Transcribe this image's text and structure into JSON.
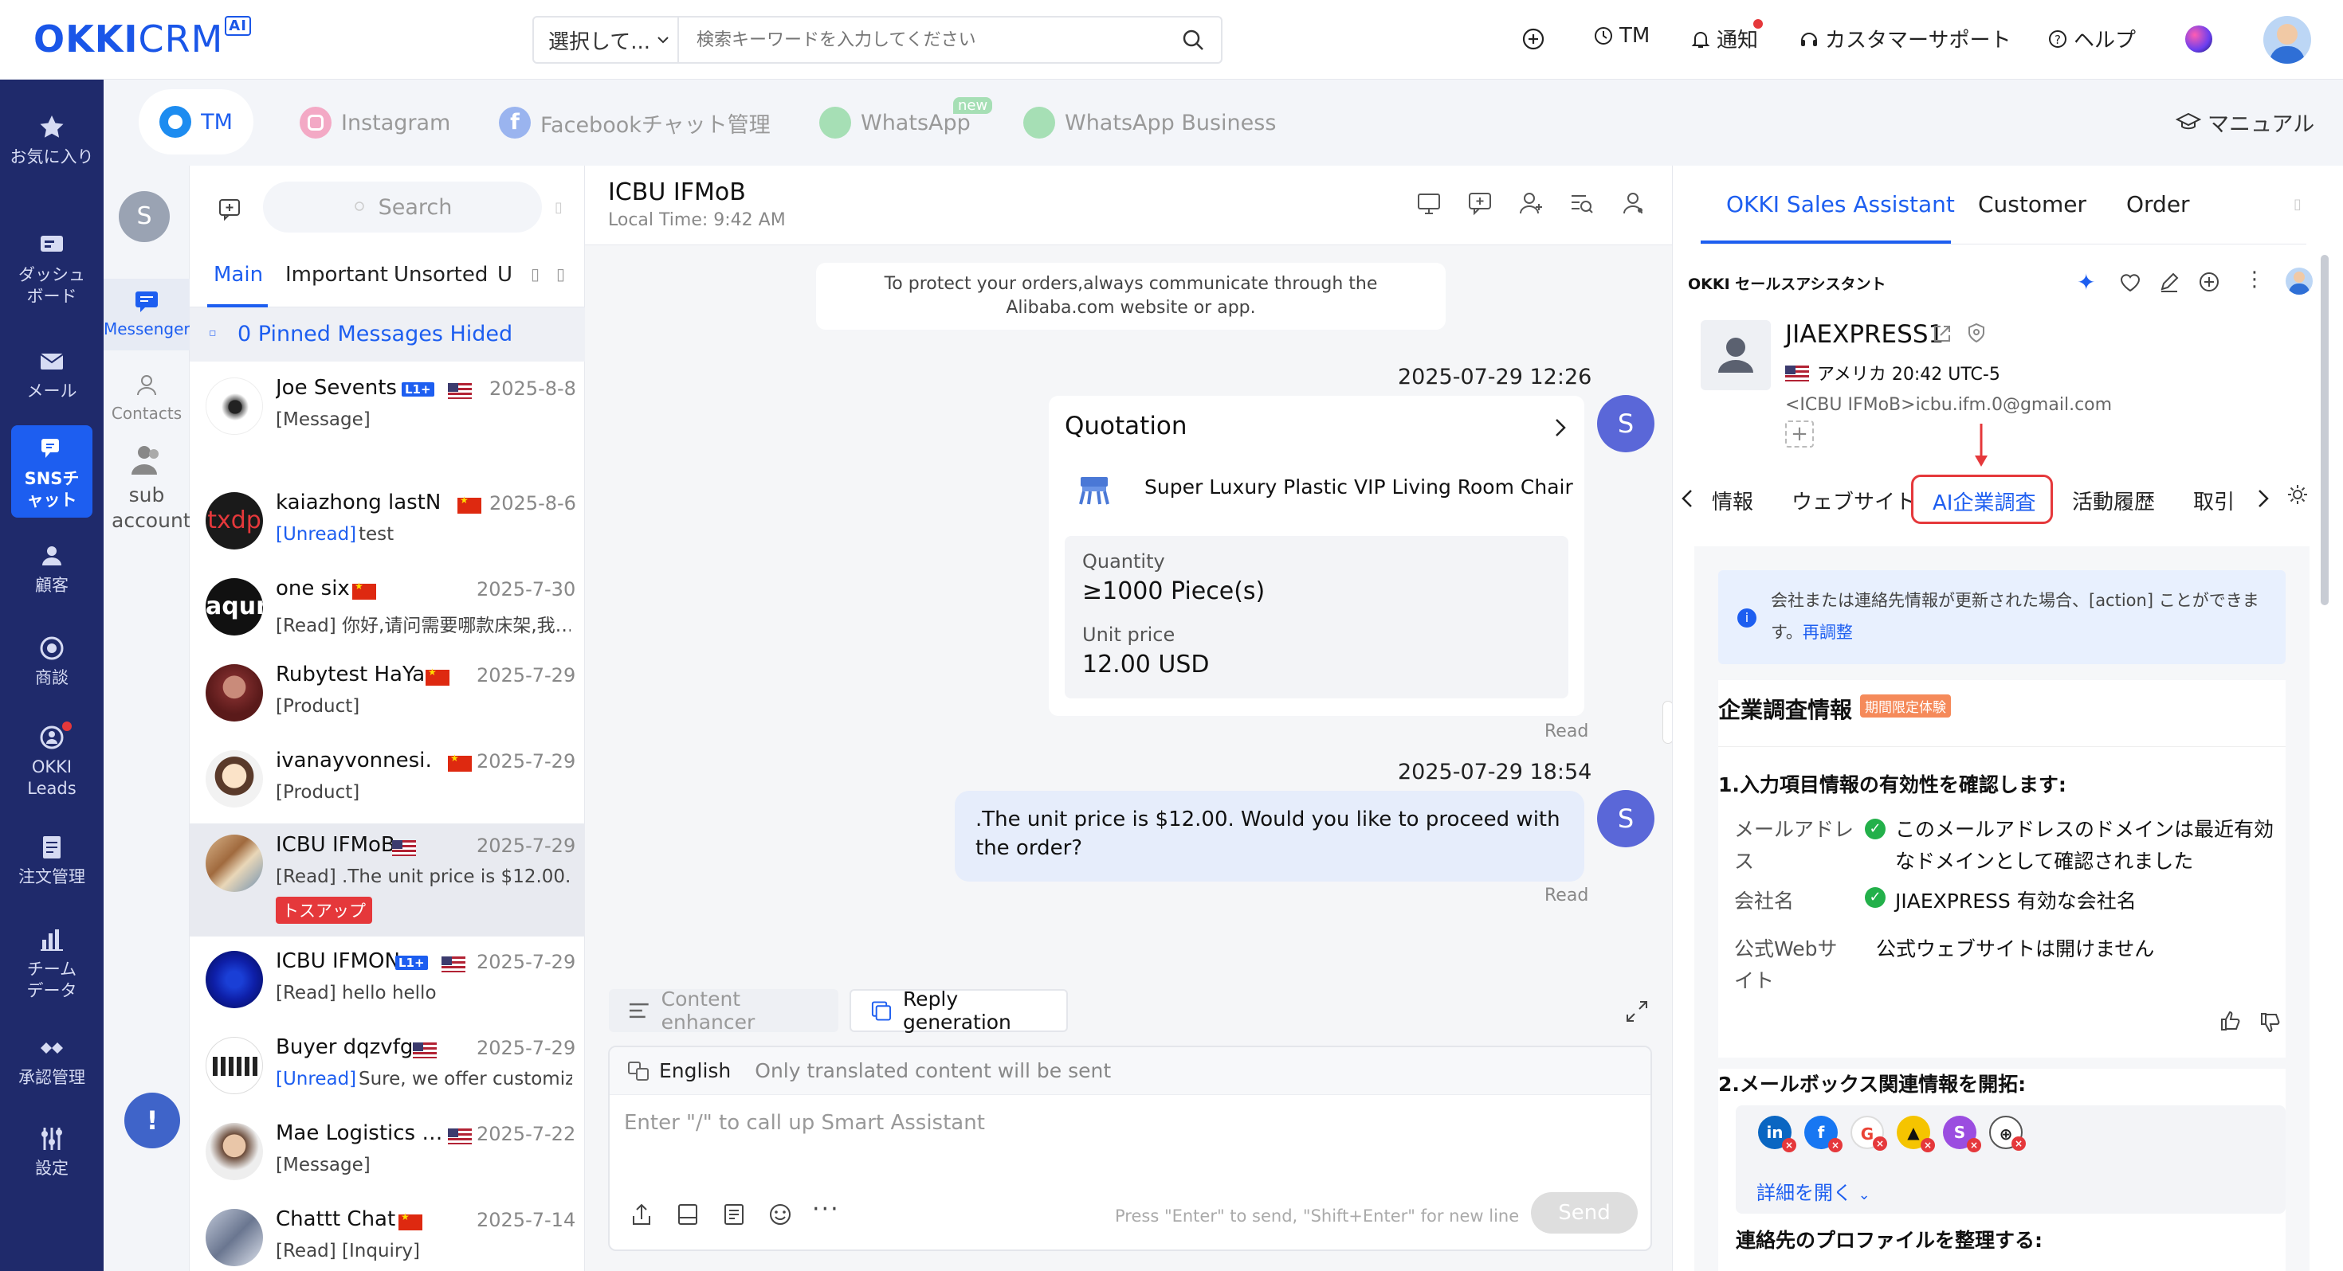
{
  "colors": {
    "primary": "#1d5ef0",
    "nav_bg": "#1f2a6b",
    "accent_red": "#e5383b",
    "tag_orange": "#f58a5a"
  },
  "topbar": {
    "logo": {
      "okki": "OKKI",
      "crm": "CRM",
      "ai": "AI"
    },
    "search_select": "選択して...",
    "search_placeholder": "検索キーワードを入力してください",
    "tm": "TM",
    "notify": "通知",
    "support": "カスタマーサポート",
    "help": "ヘルプ"
  },
  "leftnav": [
    {
      "label": "お気に入り",
      "icon": "star-icon"
    },
    {
      "label": "ダッシュボード",
      "icon": "dashboard-icon"
    },
    {
      "label": "メール",
      "icon": "mail-icon"
    },
    {
      "label": "SNSチャット",
      "icon": "chat-icon"
    },
    {
      "label": "顧客",
      "icon": "customers-icon"
    },
    {
      "label": "商談",
      "icon": "target-icon"
    },
    {
      "label": "OKKI Leads",
      "icon": "leads-icon"
    },
    {
      "label": "注文管理",
      "icon": "order-icon"
    },
    {
      "label": "チームデータ",
      "icon": "bar-chart-icon"
    },
    {
      "label": "承認管理",
      "icon": "approval-icon"
    },
    {
      "label": "設定",
      "icon": "settings-icon"
    }
  ],
  "channels": {
    "tm": "TM",
    "instagram": "Instagram",
    "facebook": "Facebookチャット管理",
    "whatsapp": "WhatsApp",
    "whatsapp_new": "new",
    "whatsapp_business": "WhatsApp Business",
    "manual": "マニュアル"
  },
  "subnav": {
    "avatar": "S",
    "messenger": "Messenger",
    "contacts": "Contacts",
    "sub_account": "sub account"
  },
  "convlist": {
    "search_placeholder": "Search",
    "tabs": [
      "Main",
      "Important",
      "Unsorted",
      "U"
    ],
    "pinned": "0 Pinned Messages Hided",
    "items": [
      {
        "name": "Joe Sevents",
        "badge": "L1+",
        "flag": "us",
        "date": "2025-8-8",
        "status": "",
        "preview": "[Message]"
      },
      {
        "name": "kaiazhong lastN…",
        "badge": "",
        "flag": "cn",
        "date": "2025-8-6",
        "status": "[Unread]",
        "preview": "test"
      },
      {
        "name": "one six",
        "badge": "",
        "flag": "cn",
        "date": "2025-7-30",
        "status": "",
        "preview": "[Read]  你好,请问需要哪款床架,我…"
      },
      {
        "name": "Rubytest HaYa",
        "badge": "",
        "flag": "cn",
        "date": "2025-7-29",
        "status": "",
        "preview": "[Product]"
      },
      {
        "name": "ivanayvonnesi…",
        "badge": "",
        "flag": "cn",
        "date": "2025-7-29",
        "status": "",
        "preview": "[Product]"
      },
      {
        "name": "ICBU IFMoB",
        "badge": "",
        "flag": "us",
        "date": "2025-7-29",
        "status": "",
        "preview": "[Read]  .The unit price is $12.00. …",
        "tag": "トスアップ"
      },
      {
        "name": "ICBU IFMON",
        "badge": "L1+",
        "flag": "us",
        "date": "2025-7-29",
        "status": "",
        "preview": "[Read]  hello hello"
      },
      {
        "name": "Buyer dqzvfg",
        "badge": "",
        "flag": "us",
        "date": "2025-7-29",
        "status": "[Unread]",
        "preview": "Sure, we offer customiz…"
      },
      {
        "name": "Mae Logistics …",
        "badge": "",
        "flag": "us",
        "date": "2025-7-22",
        "status": "",
        "preview": "[Message]"
      },
      {
        "name": "Chattt Chat",
        "badge": "",
        "flag": "cn",
        "date": "2025-7-14",
        "status": "",
        "preview": "[Read]  [Inquiry]"
      }
    ],
    "avatar_texts": {
      "txdp": "txdp",
      "aqur": "aqur"
    }
  },
  "chat": {
    "title": "ICBU IFMoB",
    "local_time": "Local Time: 9:42 AM",
    "notice": "To protect your orders,always communicate through the Alibaba.com website or app.",
    "time1": "2025-07-29 12:26",
    "quotation": {
      "title": "Quotation",
      "product": "Super Luxury Plastic VIP Living Room Chair",
      "qty_label": "Quantity",
      "qty_value": "≥1000 Piece(s)",
      "price_label": "Unit price",
      "price_value": "12.00 USD"
    },
    "read1": "Read",
    "time2": "2025-07-29 18:54",
    "message2": ".The unit price is $12.00. Would you like to proceed with the order?",
    "read2": "Read",
    "sender": "S"
  },
  "composer": {
    "content_enhancer": "Content enhancer",
    "reply_generation": "Reply generation",
    "language": "English",
    "translate_hint": "Only translated content will be sent",
    "placeholder": "Enter \"/\" to call up Smart Assistant",
    "send_hint": "Press \"Enter\" to send, \"Shift+Enter\" for new line",
    "send": "Send"
  },
  "rightpanel": {
    "tabs": [
      "OKKI Sales Assistant",
      "Customer",
      "Order"
    ],
    "assistant_label": "OKKI セールスアシスタント",
    "contact": {
      "name": "JIAEXPRESS1",
      "location": "アメリカ 20:42 UTC-5",
      "email": "<ICBU IFMoB>icbu.ifm.0@gmail.com"
    },
    "info_tabs": [
      "情報",
      "ウェブサイト",
      "AI企業調査",
      "活動履歴",
      "取引"
    ],
    "notice": "会社または連絡先情報が更新された場合、[action] ことができます。",
    "notice_link": "再調整",
    "section_title": "企業調査情報",
    "section_tag": "期間限定体験",
    "step1": "1.入力項目情報の有効性を確認します:",
    "rows": [
      {
        "label": "メールアドレス",
        "value": "このメールアドレスのドメインは最近有効なドメインとして確認されました",
        "ok": true
      },
      {
        "label": "会社名",
        "value": "JIAEXPRESS 有効な会社名",
        "ok": true
      },
      {
        "label": "公式Webサイト",
        "value": "公式ウェブサイトは開けません",
        "ok": false
      }
    ],
    "step2": "2.メールボックス関連情報を開拓:",
    "expand": "詳細を開く",
    "step3": "連絡先のプロファイルを整理する:"
  }
}
